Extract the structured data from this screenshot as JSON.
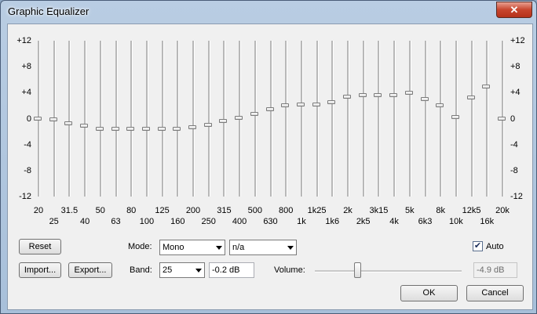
{
  "window": {
    "title": "Graphic Equalizer",
    "close_glyph": "✕"
  },
  "eq": {
    "db_scale": [
      "+12",
      "+8",
      "+4",
      "0",
      "-4",
      "-8",
      "-12"
    ],
    "db_values": [
      12,
      8,
      4,
      0,
      -4,
      -8,
      -12
    ],
    "bands": [
      {
        "freq": "20",
        "gain": 0.0,
        "row": "top"
      },
      {
        "freq": "25",
        "gain": -0.2,
        "row": "bottom"
      },
      {
        "freq": "31.5",
        "gain": -0.8,
        "row": "top"
      },
      {
        "freq": "40",
        "gain": -1.1,
        "row": "bottom"
      },
      {
        "freq": "50",
        "gain": -1.6,
        "row": "top"
      },
      {
        "freq": "63",
        "gain": -1.6,
        "row": "bottom"
      },
      {
        "freq": "80",
        "gain": -1.6,
        "row": "top"
      },
      {
        "freq": "100",
        "gain": -1.6,
        "row": "bottom"
      },
      {
        "freq": "125",
        "gain": -1.6,
        "row": "top"
      },
      {
        "freq": "160",
        "gain": -1.6,
        "row": "bottom"
      },
      {
        "freq": "200",
        "gain": -1.4,
        "row": "top"
      },
      {
        "freq": "250",
        "gain": -1.0,
        "row": "bottom"
      },
      {
        "freq": "315",
        "gain": -0.4,
        "row": "top"
      },
      {
        "freq": "400",
        "gain": 0.1,
        "row": "bottom"
      },
      {
        "freq": "500",
        "gain": 0.7,
        "row": "top"
      },
      {
        "freq": "630",
        "gain": 1.4,
        "row": "bottom"
      },
      {
        "freq": "800",
        "gain": 2.0,
        "row": "top"
      },
      {
        "freq": "1k",
        "gain": 2.1,
        "row": "bottom"
      },
      {
        "freq": "1k25",
        "gain": 2.1,
        "row": "top"
      },
      {
        "freq": "1k6",
        "gain": 2.5,
        "row": "bottom"
      },
      {
        "freq": "2k",
        "gain": 3.3,
        "row": "top"
      },
      {
        "freq": "2k5",
        "gain": 3.6,
        "row": "bottom"
      },
      {
        "freq": "3k15",
        "gain": 3.6,
        "row": "top"
      },
      {
        "freq": "4k",
        "gain": 3.6,
        "row": "bottom"
      },
      {
        "freq": "5k",
        "gain": 3.9,
        "row": "top"
      },
      {
        "freq": "6k3",
        "gain": 3.0,
        "row": "bottom"
      },
      {
        "freq": "8k",
        "gain": 2.0,
        "row": "top"
      },
      {
        "freq": "10k",
        "gain": 0.2,
        "row": "bottom"
      },
      {
        "freq": "12k5",
        "gain": 3.2,
        "row": "top"
      },
      {
        "freq": "16k",
        "gain": 4.9,
        "row": "bottom"
      },
      {
        "freq": "20k",
        "gain": 0.0,
        "row": "top"
      }
    ]
  },
  "controls": {
    "reset_label": "Reset",
    "import_label": "Import...",
    "export_label": "Export...",
    "mode_label": "Mode:",
    "mode_value": "Mono",
    "mode_extra_value": "n/a",
    "band_label": "Band:",
    "band_value": "25",
    "band_gain_value": "-0.2 dB",
    "volume_label": "Volume:",
    "volume_value": "-4.9 dB",
    "volume_level": 0.29,
    "auto_label": "Auto",
    "auto_checked": true,
    "ok_label": "OK",
    "cancel_label": "Cancel"
  },
  "colors": {
    "close_button": "#c7452d",
    "title_bar": "#b9cde3",
    "client_bg": "#f0f0f0"
  }
}
